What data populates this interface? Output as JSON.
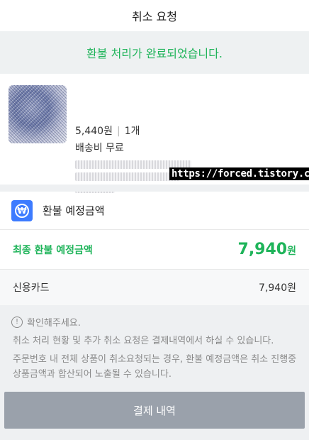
{
  "header": {
    "title": "취소 요청"
  },
  "banner": {
    "message": "환불 처리가 완료되었습니다."
  },
  "product": {
    "price": "5,440원",
    "quantity": "1개",
    "shipping": "배송비 무료"
  },
  "watermark": {
    "text": "https://forced.tistory.com"
  },
  "refund": {
    "icon": "won-icon",
    "icon_glyph": "₩",
    "section_title": "환불 예정금액",
    "final_label": "최종 환불 예정금액",
    "final_amount": "7,940",
    "final_unit": "원",
    "payment_method": "신용카드",
    "payment_amount": "7,940원"
  },
  "notice": {
    "icon": "info-icon",
    "icon_glyph": "!",
    "title": "확인해주세요.",
    "line1": "취소 처리 현황 및 추가 취소 요청은 결제내역에서 하실 수 있습니다.",
    "line2": "주문번호 내 전체 상품이 취소요청되는 경우, 환불 예정금액은 취소 진행중 상품금액과 합산되어 노출될 수 있습니다."
  },
  "footer": {
    "button_label": "결제 내역"
  },
  "colors": {
    "accent_green": "#1fb45a",
    "won_icon_blue": "#3d7bff",
    "button_gray": "#9aa1ab"
  }
}
